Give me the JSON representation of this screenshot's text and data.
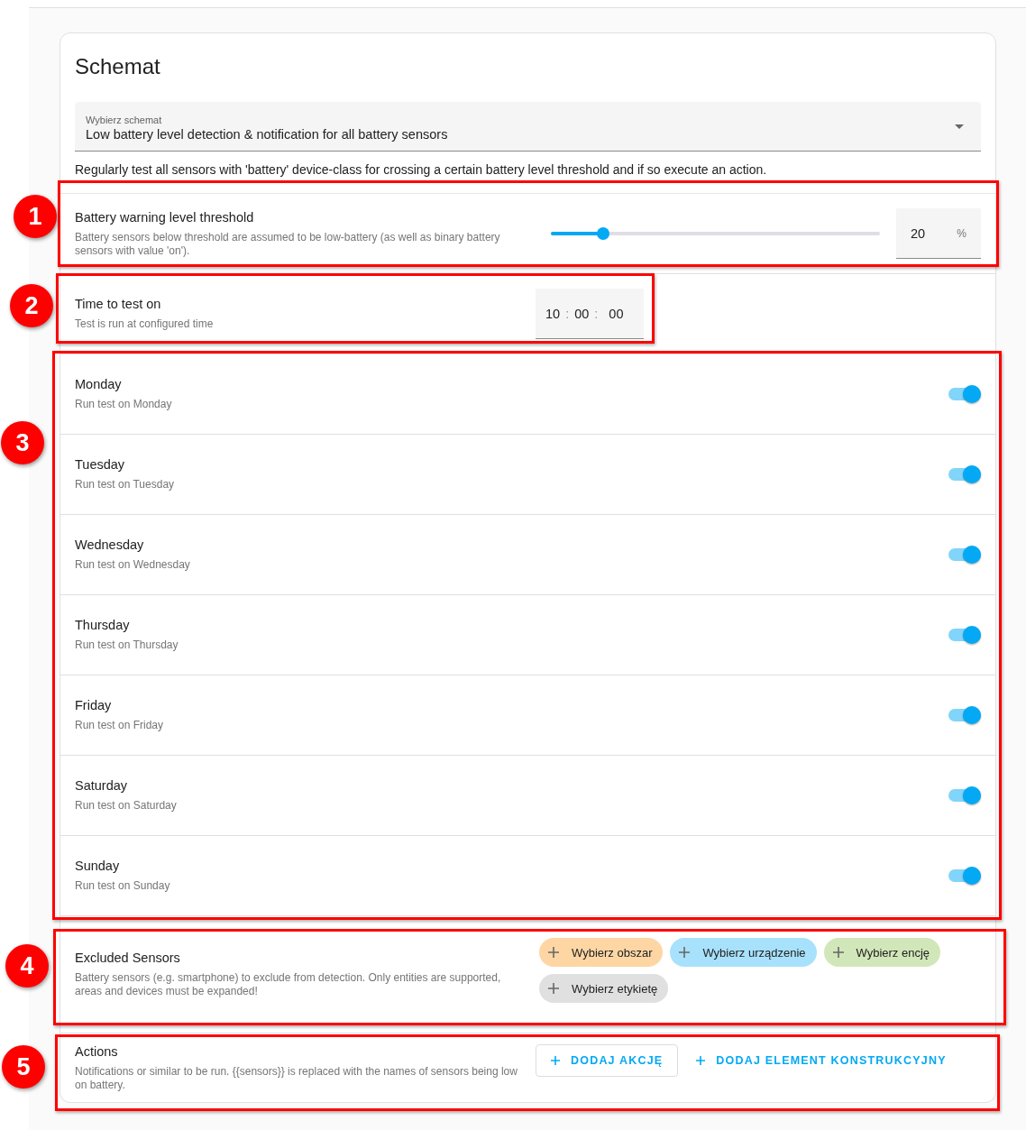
{
  "title": "Schemat",
  "blueprint_select": {
    "label": "Wybierz schemat",
    "value": "Low battery level detection & notification for all battery sensors"
  },
  "description": "Regularly test all sensors with 'battery' device-class for crossing a certain battery level threshold and if so execute an action.",
  "settings": [
    {
      "kind": "slider",
      "label": "Battery warning level threshold",
      "description": "Battery sensors below threshold are assumed to be low-battery (as well as binary battery sensors with value 'on').",
      "level": 0.16,
      "value": "20",
      "unit": "%"
    },
    {
      "kind": "time",
      "label": "Time to test on",
      "description": "Test is run at configured time",
      "hours": "10",
      "minutes": "00",
      "seconds": "00",
      "separator": ":"
    },
    {
      "kind": "toggle",
      "label": "Monday",
      "description": "Run test on Monday",
      "on": true
    },
    {
      "kind": "toggle",
      "label": "Tuesday",
      "description": "Run test on Tuesday",
      "on": true
    },
    {
      "kind": "toggle",
      "label": "Wednesday",
      "description": "Run test on Wednesday",
      "on": true
    },
    {
      "kind": "toggle",
      "label": "Thursday",
      "description": "Run test on Thursday",
      "on": true
    },
    {
      "kind": "toggle",
      "label": "Friday",
      "description": "Run test on Friday",
      "on": true
    },
    {
      "kind": "toggle",
      "label": "Saturday",
      "description": "Run test on Saturday",
      "on": true
    },
    {
      "kind": "toggle",
      "label": "Sunday",
      "description": "Run test on Sunday",
      "on": true
    },
    {
      "kind": "targets",
      "label": "Excluded Sensors",
      "description": "Battery sensors (e.g. smartphone) to exclude from detection. Only entities are supported, areas and devices must be expanded!",
      "chips": [
        {
          "label": "Wybierz obszar",
          "color": "#fed6a4"
        },
        {
          "label": "Wybierz urządzenie",
          "color": "#a8e1fb"
        },
        {
          "label": "Wybierz encję",
          "color": "#d2e7b9"
        },
        {
          "label": "Wybierz etykietę",
          "color": "#e0e0e0"
        }
      ]
    },
    {
      "kind": "actions",
      "label": "Actions",
      "description": "Notifications or similar to be run. {{sensors}} is replaced with the names of sensors being low on battery.",
      "buttons": [
        {
          "label": "DODAJ AKCJĘ",
          "kind": "outlined"
        },
        {
          "label": "DODAJ ELEMENT KONSTRUKCYJNY",
          "kind": "text"
        }
      ]
    }
  ],
  "annotations": [
    {
      "number": "1"
    },
    {
      "number": "2"
    },
    {
      "number": "3"
    },
    {
      "number": "4"
    },
    {
      "number": "5"
    }
  ]
}
